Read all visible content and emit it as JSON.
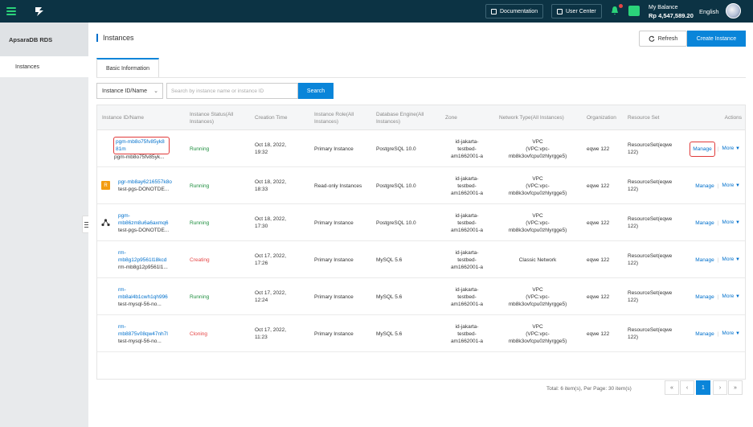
{
  "topbar": {
    "documentation": "Documentation",
    "user_center": "User Center",
    "balance_label": "My Balance",
    "balance_amount": "Rp 4,547,589.20",
    "language": "English"
  },
  "sidebar": {
    "title": "ApsaraDB RDS",
    "items": [
      {
        "label": "Instances"
      }
    ]
  },
  "main": {
    "title": "Instances",
    "refresh_label": "Refresh",
    "create_label": "Create Instance",
    "tab_label": "Basic Information",
    "filter_select": "Instance ID/Name",
    "search_placeholder": "Search by instance name or instance ID",
    "search_label": "Search"
  },
  "table": {
    "headers": {
      "id": "Instance ID/Name",
      "status": "Instance Status(All Instances)",
      "created": "Creation Time",
      "role": "Instance Role(All Instances)",
      "engine": "Database Engine(All Instances)",
      "zone": "Zone",
      "network": "Network Type(All Instances)",
      "org": "Organization",
      "rs": "Resource Set",
      "actions": "Actions"
    },
    "rows": [
      {
        "id_link": "pgm-mb8o75fv85yk881m",
        "name": "pgm-mb8o75fv85yk...",
        "status": "Running",
        "date": "Oct 18, 2022,",
        "time": "19:32",
        "role": "Primary Instance",
        "engine": "PostgreSQL 10.0",
        "zone": [
          "id-jakarta-",
          "testbed-",
          "am1662001-a"
        ],
        "network": [
          "VPC",
          "(VPC:vpc-",
          "mb8k3ovfcpu0zhlyrgge5)"
        ],
        "org": "eqwe 122",
        "rs": [
          "ResourceSet(eqwe",
          "122)"
        ],
        "manage": "Manage",
        "more": "More"
      },
      {
        "id_link": "pgr-mb8ay6216557k8o",
        "name": "test-pgs-DONOTDE...",
        "status": "Running",
        "date": "Oct 18, 2022,",
        "time": "18:33",
        "role": "Read-only Instances",
        "engine": "PostgreSQL 10.0",
        "zone": [
          "id-jakarta-",
          "testbed-",
          "am1662001-a"
        ],
        "network": [
          "VPC",
          "(VPC:vpc-",
          "mb8k3ovfcpu0zhlyrgge5)"
        ],
        "org": "eqwe 122",
        "rs": [
          "ResourceSet(eqwe",
          "122)"
        ],
        "manage": "Manage",
        "more": "More"
      },
      {
        "id_link_1": "pgm-",
        "id_link_2": "mb86zm8u6a6axmq6",
        "name": "test-pgs-DONOTDE...",
        "status": "Running",
        "date": "Oct 18, 2022,",
        "time": "17:30",
        "role": "Primary Instance",
        "engine": "PostgreSQL 10.0",
        "zone": [
          "id-jakarta-",
          "testbed-",
          "am1662001-a"
        ],
        "network": [
          "VPC",
          "(VPC:vpc-",
          "mb8k3ovfcpu0zhlyrgge5)"
        ],
        "org": "eqwe 122",
        "rs": [
          "ResourceSet(eqwe",
          "122)"
        ],
        "manage": "Manage",
        "more": "More"
      },
      {
        "id_link_1": "rm-",
        "id_link_2": "mb8g12p9561l18kcd",
        "name": "rm-mb8g12p9561l1...",
        "status": "Creating",
        "date": "Oct 17, 2022,",
        "time": "17:26",
        "role": "Primary Instance",
        "engine": "MySQL 5.6",
        "zone": [
          "id-jakarta-",
          "testbed-",
          "am1662001-a"
        ],
        "network": [
          "Classic Network"
        ],
        "org": "eqwe 122",
        "rs": [
          "ResourceSet(eqwe",
          "122)"
        ],
        "manage": "Manage",
        "more": "More"
      },
      {
        "id_link_1": "rm-",
        "id_link_2": "mb8al4b1cwh1qh996",
        "name": "test-mysql-56-no...",
        "status": "Running",
        "date": "Oct 17, 2022,",
        "time": "12:24",
        "role": "Primary Instance",
        "engine": "MySQL 5.6",
        "zone": [
          "id-jakarta-",
          "testbed-",
          "am1662001-a"
        ],
        "network": [
          "VPC",
          "(VPC:vpc-",
          "mb8k3ovfcpu0zhlyrgge5)"
        ],
        "org": "eqwe 122",
        "rs": [
          "ResourceSet(eqwe",
          "122)"
        ],
        "manage": "Manage",
        "more": "More"
      },
      {
        "id_link_1": "rm-",
        "id_link_2": "mb8875v08qw47nh7l",
        "name": "test-mysql-56-no...",
        "status": "Cloning",
        "date": "Oct 17, 2022,",
        "time": "11:23",
        "role": "Primary Instance",
        "engine": "MySQL 5.6",
        "zone": [
          "id-jakarta-",
          "testbed-",
          "am1662001-a"
        ],
        "network": [
          "VPC",
          "(VPC:vpc-",
          "mb8k3ovfcpu0zhlyrgge5)"
        ],
        "org": "eqwe 122",
        "rs": [
          "ResourceSet(eqwe",
          "122)"
        ],
        "manage": "Manage",
        "more": "More"
      }
    ]
  },
  "pagination": {
    "total": "Total: 6 item(s),  Per Page: 30 item(s)",
    "first": "«",
    "prev": "‹",
    "current": "1",
    "next": "›",
    "last": "»"
  },
  "colors": {
    "accent": "#0a85d9",
    "topbar": "#0c3344",
    "running": "#1e8e3e",
    "creating": "#e54545"
  }
}
